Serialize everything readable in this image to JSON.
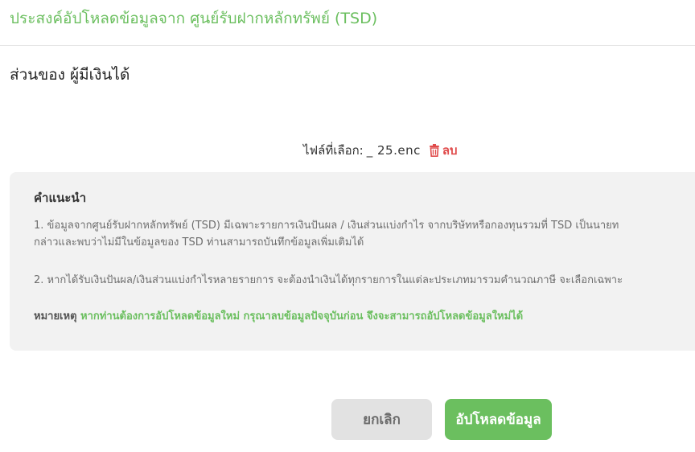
{
  "page": {
    "title": "ประสงค์อัปโหลดข้อมูลจาก ศูนย์รับฝากหลักทรัพย์ (TSD)",
    "section_label": "ส่วนของ ผู้มีเงินได้"
  },
  "file": {
    "label": "ไฟล์ที่เลือก:",
    "name_masked": "                          ",
    "name_visible_fragment": "_ 25.enc",
    "delete_label": "ลบ",
    "delete_icon": "trash-icon"
  },
  "note": {
    "heading": "คำแนะนำ",
    "item1_line1": "1. ข้อมูลจากศูนย์รับฝากหลักทรัพย์ (TSD) มีเฉพาะรายการเงินปันผล / เงินส่วนแบ่งกำไร จากบริษัทหรือกองทุนรวมที่ TSD เป็นนายท",
    "item1_line2": "กล่าวและพบว่าไม่มีในข้อมูลของ TSD ท่านสามารถบันทึกข้อมูลเพิ่มเติมได้",
    "item2": "2. หากได้รับเงินปันผล/เงินส่วนแบ่งกำไรหลายรายการ จะต้องนำเงินได้ทุกรายการในแต่ละประเภทมารวมคำนวณภาษี จะเลือกเฉพาะ",
    "remark_label": "หมายเหตุ",
    "remark_text": "หากท่านต้องการอัปโหลดข้อมูลใหม่ กรุณาลบข้อมูลปัจจุบันก่อน จึงจะสามารถอัปโหลดข้อมูลใหม่ได้"
  },
  "actions": {
    "cancel_label": "ยกเลิก",
    "upload_label": "อัปโหลดข้อมูล"
  },
  "colors": {
    "accent_green": "#6bbf5f",
    "danger_red": "#e04b4b",
    "note_bg": "#f2f2f2",
    "cancel_bg": "#e2e2e2"
  }
}
